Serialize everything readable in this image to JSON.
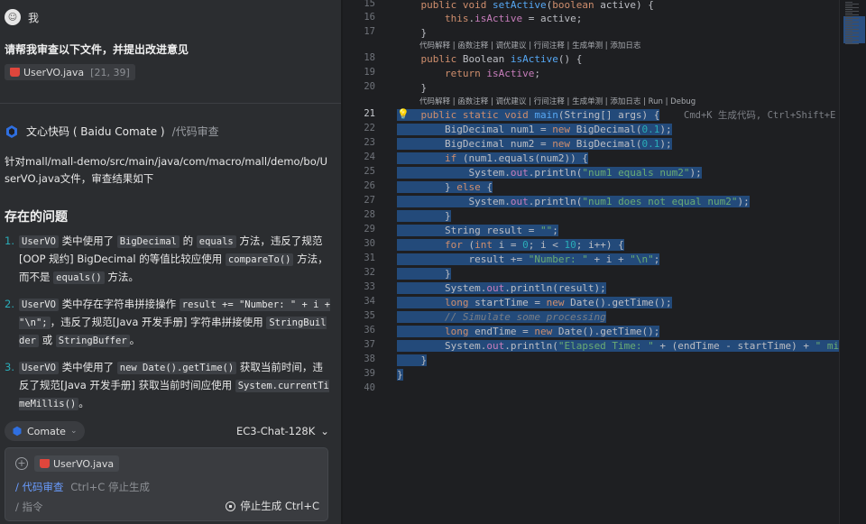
{
  "chat": {
    "user_name": "我",
    "request": "请帮我审查以下文件，并提出改进意见",
    "attached_file": {
      "name": "UserVO.java",
      "range": "[21, 39]"
    },
    "bot_name": "文心快码 ( Baidu Comate )",
    "bot_tag": "/代码审查",
    "summary": "针对mall/mall-demo/src/main/java/com/macro/mall/demo/bo/UserVO.java文件，审查结果如下",
    "section_title": "存在的问题",
    "issues": [
      {
        "num": "1.",
        "parts": [
          "UserVO",
          " 类中使用了 ",
          "BigDecimal",
          " 的 ",
          "equals",
          " 方法，违反了规范[OOP 规约] BigDecimal 的等值比较应使用 ",
          "compareTo()",
          " 方法，而不是 ",
          "equals()",
          " 方法。"
        ]
      },
      {
        "num": "2.",
        "parts": [
          "UserVO",
          " 类中存在字符串拼接操作 ",
          "result += \"Number: \" + i + \"\\n\";",
          "，违反了规范[Java 开发手册] 字符串拼接使用 ",
          "StringBuilder",
          " 或 ",
          "StringBuffer",
          "。"
        ]
      },
      {
        "num": "3.",
        "parts": [
          "UserVO",
          " 类中使用了 ",
          "new Date().getTime()",
          " 获取当前时间，违反了规范[Java 开发手册] 获取当前时间应使用 ",
          "System.currentTimeMillis()",
          "。"
        ]
      }
    ],
    "mode_label": "Comate",
    "model_label": "EC3-Chat-128K",
    "input": {
      "file_name": "UserVO.java",
      "command": "/ 代码审查",
      "command_hint": "Ctrl+C 停止生成",
      "prompt": "/ 指令",
      "stop_label": "停止生成 Ctrl+C"
    }
  },
  "editor": {
    "lens_1": "代码解释 | 函数注释 | 调优建议 | 行间注释 | 生成单测 | 添加日志",
    "lens_2": "代码解释 | 函数注释 | 调优建议 | 行间注释 | 生成单测 | 添加日志 | Run | Debug",
    "ghost_hint": "Cmd+K 生成代码, Ctrl+Shift+E",
    "line_numbers": [
      "15",
      "16",
      "17",
      "18",
      "19",
      "20",
      "21",
      "22",
      "23",
      "24",
      "25",
      "26",
      "27",
      "28",
      "29",
      "30",
      "31",
      "32",
      "33",
      "34",
      "35",
      "36",
      "37",
      "38",
      "39",
      "40"
    ]
  },
  "colors": {
    "accent": "#2e5d9a",
    "selection": "#234a7a",
    "keyword": "#cf8e6d",
    "function": "#56a8f5",
    "string": "#6aab73",
    "number": "#2aacb8"
  },
  "icons": [
    "avatar-icon",
    "java-file-icon",
    "comate-logo-icon",
    "chevron-down-icon",
    "add-icon",
    "lightbulb-icon",
    "stop-icon"
  ]
}
